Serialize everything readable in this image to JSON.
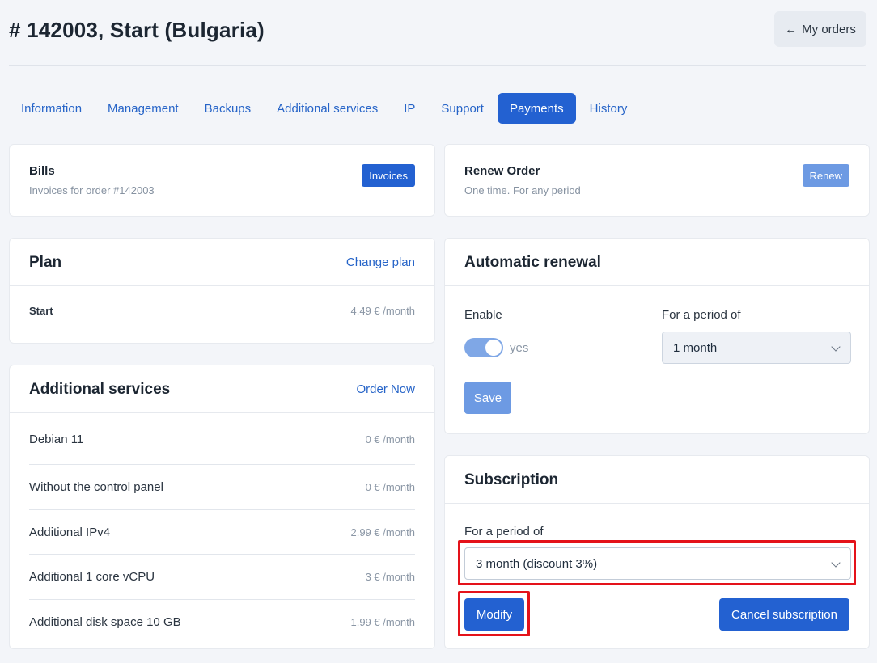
{
  "header": {
    "title": "# 142003, Start (Bulgaria)",
    "back_label": "My orders",
    "back_icon": "arrow-left-icon"
  },
  "tabs": [
    {
      "label": "Information",
      "active": false
    },
    {
      "label": "Management",
      "active": false
    },
    {
      "label": "Backups",
      "active": false
    },
    {
      "label": "Additional services",
      "active": false
    },
    {
      "label": "IP",
      "active": false
    },
    {
      "label": "Support",
      "active": false
    },
    {
      "label": "Payments",
      "active": true
    },
    {
      "label": "History",
      "active": false
    }
  ],
  "bills": {
    "title": "Bills",
    "subtitle": "Invoices for order #142003",
    "button": "Invoices"
  },
  "renew": {
    "title": "Renew Order",
    "subtitle": "One time. For any period",
    "button": "Renew"
  },
  "plan": {
    "title": "Plan",
    "link": "Change plan",
    "name": "Start",
    "price": "4.49 € /month"
  },
  "services": {
    "title": "Additional services",
    "link": "Order Now",
    "items": [
      {
        "name": "Debian 11",
        "price": "0 € /month"
      },
      {
        "name": "Without the control panel",
        "price": "0 € /month"
      },
      {
        "name": "Additional IPv4",
        "price": "2.99 € /month"
      },
      {
        "name": "Additional 1 core vCPU",
        "price": "3 € /month"
      },
      {
        "name": "Additional disk space 10 GB",
        "price": "1.99 € /month"
      }
    ]
  },
  "auto_renewal": {
    "title": "Automatic renewal",
    "enable_label": "Enable",
    "toggle_text": "yes",
    "toggle_on": true,
    "period_label": "For a period of",
    "period_value": "1 month",
    "save": "Save"
  },
  "subscription": {
    "title": "Subscription",
    "period_label": "For a period of",
    "period_value": "3 month (discount 3%)",
    "modify": "Modify",
    "cancel": "Cancel subscription"
  },
  "colors": {
    "accent": "#2361d1",
    "accent_light": "#6d9ae3",
    "highlight": "#e4121a"
  }
}
